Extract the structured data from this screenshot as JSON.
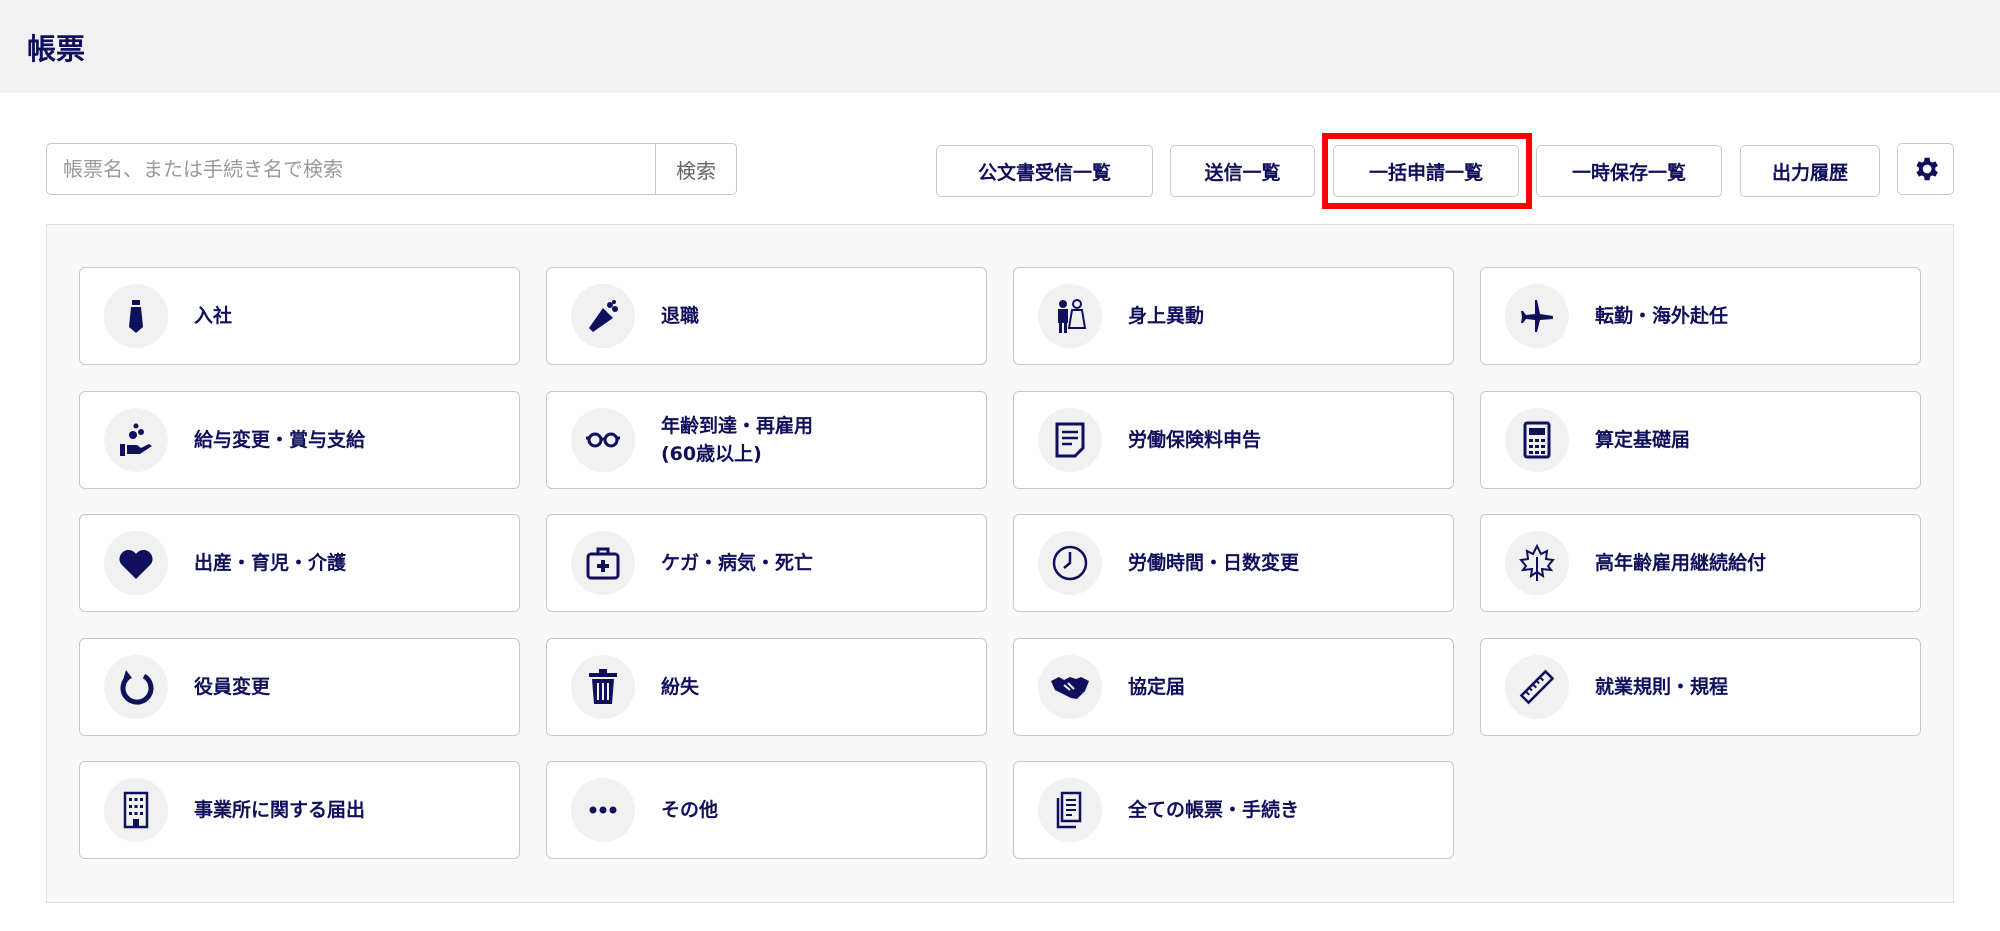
{
  "header": {
    "title": "帳票"
  },
  "search": {
    "placeholder": "帳票名、または手続き名で検索",
    "button": "検索"
  },
  "toolbar": {
    "buttons": [
      "公文書受信一覧",
      "送信一覧",
      "一括申請一覧",
      "一時保存一覧",
      "出力履歴"
    ],
    "settings_icon": "gear-icon"
  },
  "highlight_color": "#ff0000",
  "categories": [
    {
      "label": "入社",
      "icon": "tie-icon"
    },
    {
      "label": "退職",
      "icon": "bouquet-icon"
    },
    {
      "label": "身上異動",
      "icon": "wedding-couple-icon"
    },
    {
      "label": "転勤・海外赴任",
      "icon": "airplane-icon"
    },
    {
      "label": "給与変更・賞与支給",
      "icon": "hand-coins-icon"
    },
    {
      "label": "年齢到達・再雇用\n(60歳以上)",
      "icon": "glasses-icon"
    },
    {
      "label": "労働保険料申告",
      "icon": "document-icon"
    },
    {
      "label": "算定基礎届",
      "icon": "calculator-icon"
    },
    {
      "label": "出産・育児・介護",
      "icon": "heart-icon"
    },
    {
      "label": "ケガ・病気・死亡",
      "icon": "first-aid-kit-icon"
    },
    {
      "label": "労働時間・日数変更",
      "icon": "clock-icon"
    },
    {
      "label": "高年齢雇用継続給付",
      "icon": "maple-leaf-icon"
    },
    {
      "label": "役員変更",
      "icon": "refresh-icon"
    },
    {
      "label": "紛失",
      "icon": "trash-icon"
    },
    {
      "label": "協定届",
      "icon": "handshake-icon"
    },
    {
      "label": "就業規則・規程",
      "icon": "ruler-icon"
    },
    {
      "label": "事業所に関する届出",
      "icon": "building-icon"
    },
    {
      "label": "その他",
      "icon": "ellipsis-icon"
    },
    {
      "label": "全ての帳票・手続き",
      "icon": "documents-icon"
    }
  ]
}
